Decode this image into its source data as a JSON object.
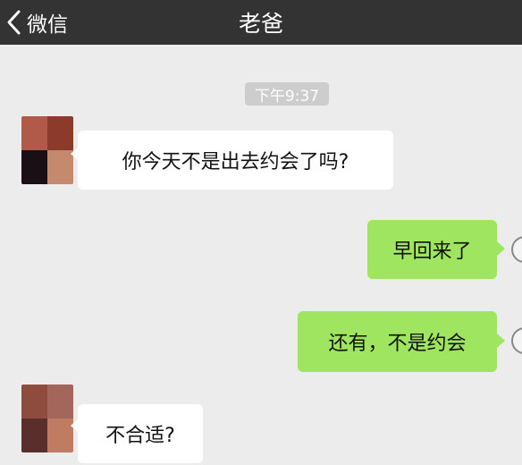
{
  "header": {
    "back_label": "微信",
    "title": "老爸"
  },
  "colors": {
    "header_bg": "#333333",
    "chat_bg": "#ececec",
    "bubble_received": "#ffffff",
    "bubble_sent": "#9fe55f"
  },
  "messages": [
    {
      "time": "下午9:37"
    },
    {
      "from": "father",
      "text": "你今天不是出去约会了吗?"
    },
    {
      "from": "me",
      "text": "早回来了"
    },
    {
      "from": "me",
      "text": "还有，不是约会"
    },
    {
      "from": "father",
      "text": "不合适?"
    }
  ]
}
